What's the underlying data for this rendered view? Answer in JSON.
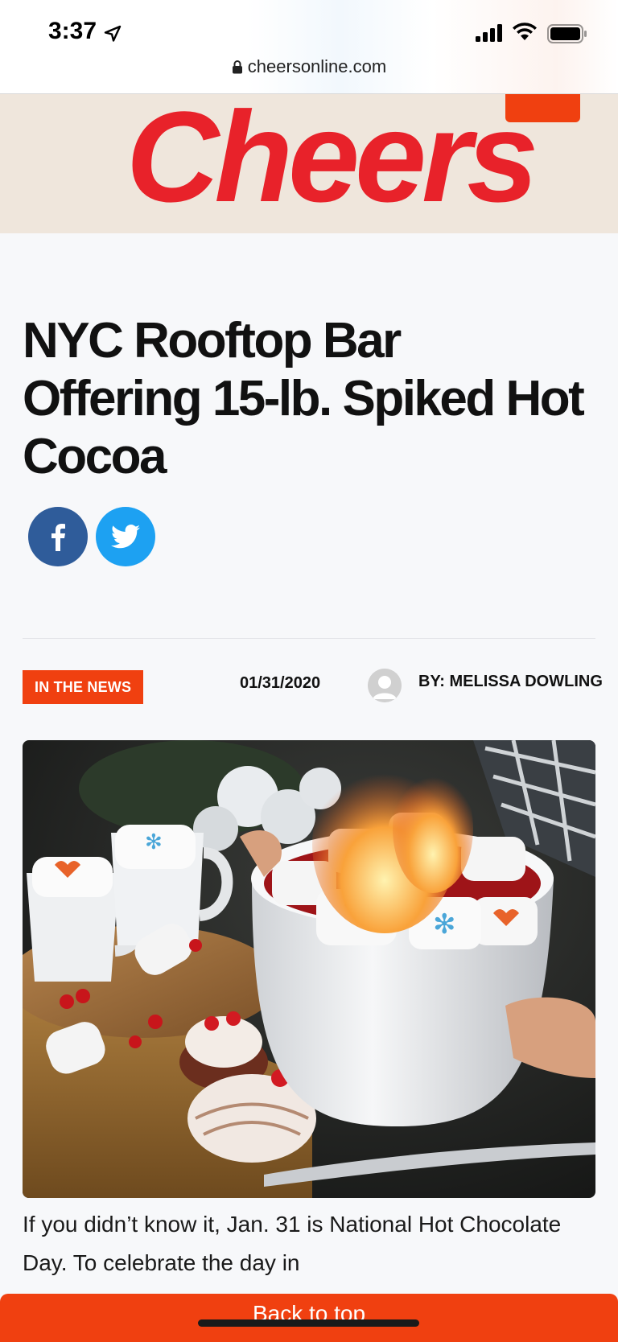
{
  "status_bar": {
    "time": "3:37",
    "icons": [
      "location-arrow-icon",
      "signal-icon",
      "wifi-icon",
      "battery-icon"
    ]
  },
  "browser": {
    "url": "cheersonline.com"
  },
  "site": {
    "logo_text": "Cheers",
    "brand_color": "#e8222a",
    "accent_color": "#f04010"
  },
  "article": {
    "title": "NYC Rooftop Bar Offering 15-lb. Spiked Hot Cocoa",
    "share": [
      "facebook-icon",
      "twitter-icon"
    ],
    "category": "IN THE NEWS",
    "date": "01/31/2020",
    "author": "BY: MELISSA DOWLING",
    "body_visible": "If you didn’t know it, Jan. 31 is National Hot Chocolate Day. To celebrate the day in"
  },
  "footer": {
    "back_to_top": "Back to top"
  }
}
